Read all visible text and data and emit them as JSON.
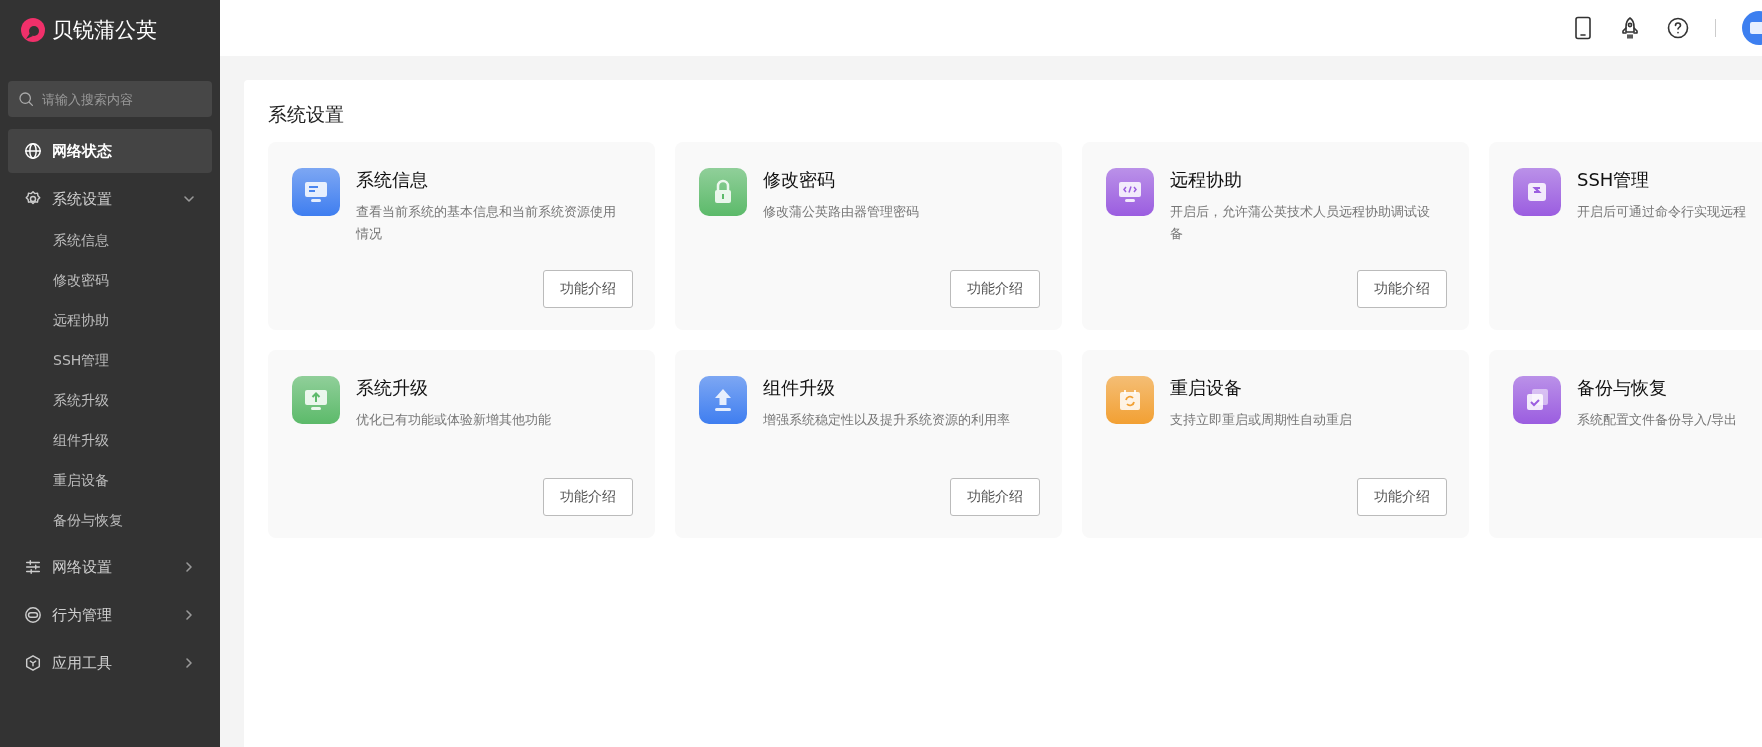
{
  "brand": {
    "name": "贝锐蒲公英"
  },
  "search": {
    "placeholder": "请输入搜索内容"
  },
  "menu": [
    {
      "label": "网络状态",
      "kind": "globe",
      "selected": true
    },
    {
      "label": "系统设置",
      "kind": "gear",
      "selected": false,
      "expanded": true,
      "children": [
        {
          "label": "系统信息"
        },
        {
          "label": "修改密码"
        },
        {
          "label": "远程协助"
        },
        {
          "label": "SSH管理"
        },
        {
          "label": "系统升级"
        },
        {
          "label": "组件升级"
        },
        {
          "label": "重启设备"
        },
        {
          "label": "备份与恢复"
        }
      ]
    },
    {
      "label": "网络设置",
      "kind": "sliders",
      "selected": false,
      "expanded": false
    },
    {
      "label": "行为管理",
      "kind": "toggle",
      "selected": false,
      "expanded": false
    },
    {
      "label": "应用工具",
      "kind": "cube",
      "selected": false,
      "expanded": false
    }
  ],
  "page": {
    "title": "系统设置"
  },
  "cards": [
    {
      "title": "系统信息",
      "description": "查看当前系统的基本信息和当前系统资源使用情况",
      "kind": "monitor",
      "color": "#3f7ef0",
      "button": "功能介绍"
    },
    {
      "title": "修改密码",
      "description": "修改蒲公英路由器管理密码",
      "kind": "lock",
      "color": "#5cba6a",
      "button": "功能介绍"
    },
    {
      "title": "远程协助",
      "description": "开启后，允许蒲公英技术人员远程协助调试设备",
      "kind": "code",
      "color": "#9b5de0",
      "button": "功能介绍"
    },
    {
      "title": "SSH管理",
      "description": "开启后可通过命令行实现远程",
      "kind": "ssh",
      "color": "#9b5de0"
    },
    {
      "title": "系统升级",
      "description": "优化已有功能或体验新增其他功能",
      "kind": "upgrade",
      "color": "#5cba6a",
      "button": "功能介绍"
    },
    {
      "title": "组件升级",
      "description": "增强系统稳定性以及提升系统资源的利用率",
      "kind": "upload",
      "color": "#3f7ef0",
      "button": "功能介绍"
    },
    {
      "title": "重启设备",
      "description": "支持立即重启或周期性自动重启",
      "kind": "restart",
      "color": "#f2a033",
      "button": "功能介绍"
    },
    {
      "title": "备份与恢复",
      "description": "系统配置文件备份导入/导出",
      "kind": "backup",
      "color": "#9b5de0"
    }
  ]
}
